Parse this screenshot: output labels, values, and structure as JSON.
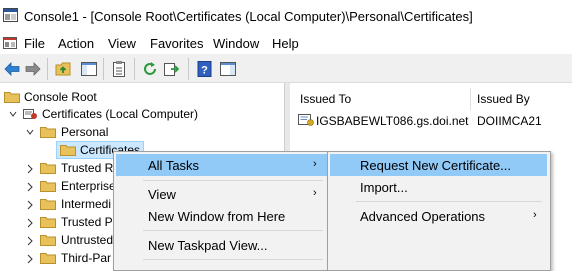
{
  "window": {
    "title": "Console1 - [Console Root\\Certificates (Local Computer)\\Personal\\Certificates]"
  },
  "menubar": {
    "items": [
      "File",
      "Action",
      "View",
      "Favorites",
      "Window",
      "Help"
    ]
  },
  "toolbar": {
    "icons": [
      "back-arrow-icon",
      "forward-arrow-icon",
      "up-folder-icon",
      "show-hide-tree-icon",
      "properties-icon",
      "refresh-icon",
      "export-list-icon",
      "help-icon",
      "show-hide-action-pane-icon"
    ]
  },
  "tree": {
    "root": "Console Root",
    "certs": "Certificates (Local Computer)",
    "personal": "Personal",
    "certificates": "Certificates",
    "truncated": [
      "Trusted R",
      "Enterprise",
      "Intermedi",
      "Trusted Pu",
      "Untrusted",
      "Third-Par"
    ]
  },
  "list": {
    "headers": {
      "issued_to": "Issued To",
      "issued_by": "Issued By"
    },
    "rows": [
      {
        "issued_to": "IGSBABEWLT086.gs.doi.net",
        "issued_by": "DOIIMCA21"
      }
    ]
  },
  "context_menu": {
    "all_tasks": "All Tasks",
    "view": "View",
    "new_window": "New Window from Here",
    "new_taskpad": "New Taskpad View..."
  },
  "submenu": {
    "request_new": "Request New Certificate...",
    "import": "Import...",
    "advanced": "Advanced Operations"
  },
  "colors": {
    "highlight": "#91c9f7",
    "selection": "#cce8ff",
    "folder": "#e8c15a"
  }
}
